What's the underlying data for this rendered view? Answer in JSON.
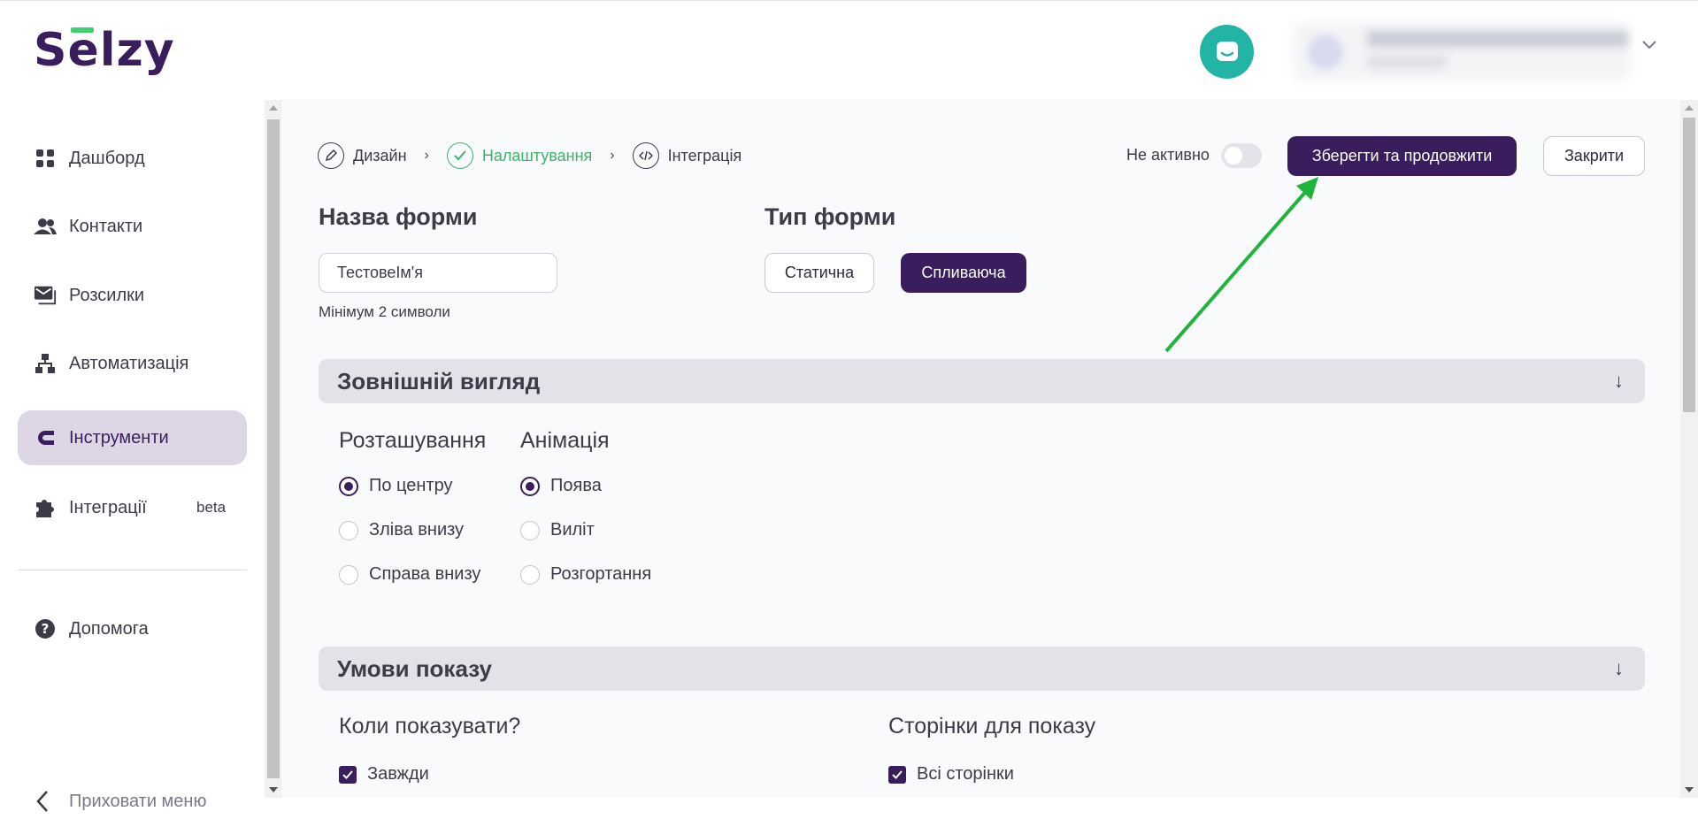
{
  "app": {
    "logo": "Selzy"
  },
  "header": {
    "chat_icon": "chat-bubble-icon",
    "user_menu_icon": "chevron-down-icon"
  },
  "sidebar": {
    "items": [
      {
        "label": "Дашборд",
        "icon": "dashboard-grid-icon"
      },
      {
        "label": "Контакти",
        "icon": "people-icon"
      },
      {
        "label": "Розсилки",
        "icon": "mail-stack-icon"
      },
      {
        "label": "Автоматизація",
        "icon": "sitemap-icon"
      },
      {
        "label": "Інструменти",
        "icon": "magnet-icon",
        "active": true
      },
      {
        "label": "Інтеграції",
        "icon": "puzzle-icon",
        "badge": "beta"
      },
      {
        "label": "Допомога",
        "icon": "help-circle-icon"
      }
    ],
    "hide_menu": "Приховати меню"
  },
  "steps": [
    {
      "label": "Дизайн",
      "icon": "pencil-icon"
    },
    {
      "label": "Налаштування",
      "icon": "check-icon",
      "status": "done"
    },
    {
      "label": "Інтеграція",
      "icon": "code-icon"
    }
  ],
  "toolbar": {
    "toggle_label": "Не активно",
    "save_label": "Зберегти та продовжити",
    "close_label": "Закрити"
  },
  "form_name": {
    "title": "Назва форми",
    "value": "ТестовеІм'я",
    "hint": "Мінімум 2 символи"
  },
  "form_type": {
    "title": "Тип форми",
    "options": [
      "Статична",
      "Спливаюча"
    ],
    "selected": "Спливаюча"
  },
  "appearance": {
    "title": "Зовнішній вигляд",
    "position_title": "Розташування",
    "positions": [
      "По центру",
      "Зліва внизу",
      "Справа внизу"
    ],
    "position_selected": "По центру",
    "animation_title": "Анімація",
    "animations": [
      "Поява",
      "Виліт",
      "Розгортання"
    ],
    "animation_selected": "Поява"
  },
  "display": {
    "title": "Умови показу",
    "when_title": "Коли показувати?",
    "when_always": "Завжди",
    "pages_title": "Сторінки для показу",
    "pages_all": "Всі сторінки"
  },
  "colors": {
    "brand": "#3a1d5c",
    "success": "#3fb36a",
    "annotation": "#1fb43a",
    "chat": "#22b5a6"
  }
}
